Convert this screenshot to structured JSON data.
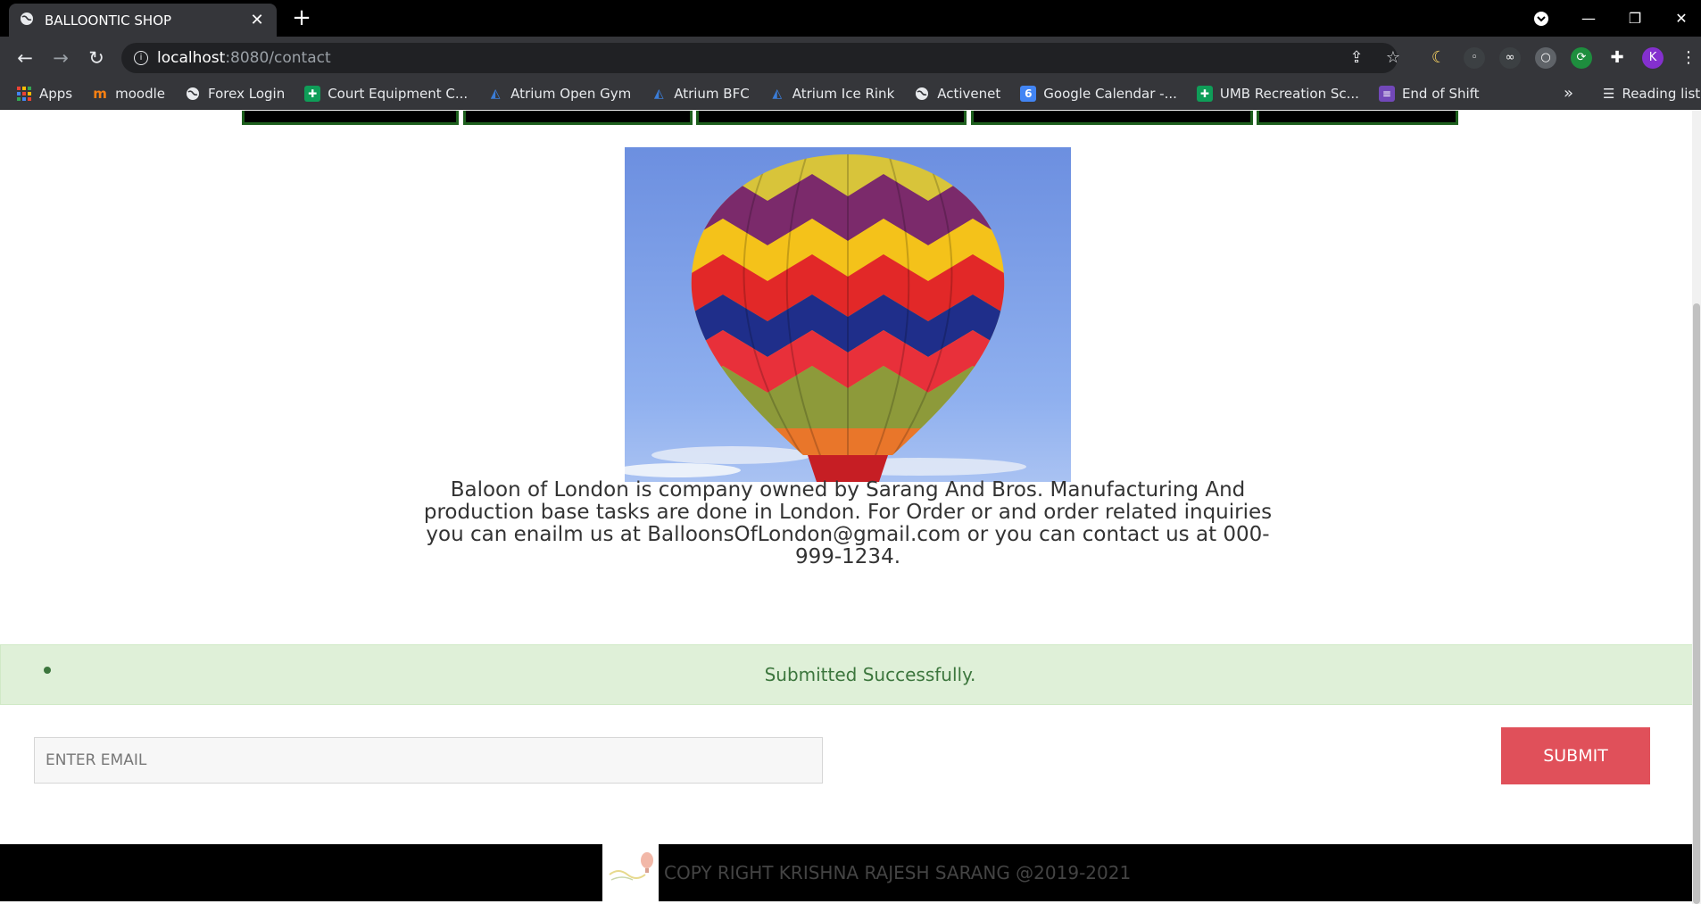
{
  "browser": {
    "tab_title": "BALLOONTIC SHOP",
    "url_host": "localhost",
    "url_path": ":8080/contact",
    "profile_initial": "K"
  },
  "bookmarks": [
    {
      "label": "Apps",
      "icon": "apps-grid-icon"
    },
    {
      "label": "moodle",
      "icon": "moodle-icon"
    },
    {
      "label": "Forex Login",
      "icon": "globe-icon"
    },
    {
      "label": "Court Equipment C...",
      "icon": "sheets-icon"
    },
    {
      "label": "Atrium Open Gym",
      "icon": "activenet-icon"
    },
    {
      "label": "Atrium BFC",
      "icon": "activenet-icon"
    },
    {
      "label": "Atrium Ice Rink",
      "icon": "activenet-icon"
    },
    {
      "label": "Activenet",
      "icon": "globe-icon"
    },
    {
      "label": "Google Calendar -...",
      "icon": "calendar-icon"
    },
    {
      "label": "UMB Recreation Sc...",
      "icon": "sheets-icon"
    },
    {
      "label": "End of Shift",
      "icon": "forms-icon"
    }
  ],
  "bookmarks_more": "»",
  "reading_list": "Reading list",
  "calendar_day": "6",
  "page": {
    "about_text": "Baloon of London is company owned by Sarang And Bros. Manufacturing And production base tasks are done in London. For Order or and order related inquiries you can enailm us at BalloonsOfLondon@gmail.com or you can contact us at 000-999-1234.",
    "alert_message": "Submitted Successfully.",
    "email_placeholder": "ENTER EMAIL",
    "submit_label": "SUBMIT",
    "footer_text": "COPY RIGHT KRISHNA RAJESH SARANG @2019-2021"
  },
  "colors": {
    "alert_bg": "#dff0d8",
    "alert_text": "#3c763d",
    "submit_bg": "#e0505a",
    "footer_bg": "#000000"
  }
}
